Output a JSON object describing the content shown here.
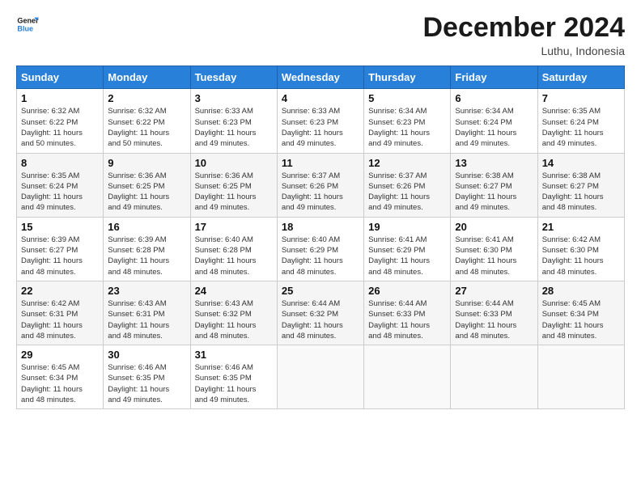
{
  "logo": {
    "line1": "General",
    "line2": "Blue"
  },
  "title": "December 2024",
  "location": "Luthu, Indonesia",
  "days_header": [
    "Sunday",
    "Monday",
    "Tuesday",
    "Wednesday",
    "Thursday",
    "Friday",
    "Saturday"
  ],
  "weeks": [
    [
      {
        "day": "1",
        "info": "Sunrise: 6:32 AM\nSunset: 6:22 PM\nDaylight: 11 hours\nand 50 minutes."
      },
      {
        "day": "2",
        "info": "Sunrise: 6:32 AM\nSunset: 6:22 PM\nDaylight: 11 hours\nand 50 minutes."
      },
      {
        "day": "3",
        "info": "Sunrise: 6:33 AM\nSunset: 6:23 PM\nDaylight: 11 hours\nand 49 minutes."
      },
      {
        "day": "4",
        "info": "Sunrise: 6:33 AM\nSunset: 6:23 PM\nDaylight: 11 hours\nand 49 minutes."
      },
      {
        "day": "5",
        "info": "Sunrise: 6:34 AM\nSunset: 6:23 PM\nDaylight: 11 hours\nand 49 minutes."
      },
      {
        "day": "6",
        "info": "Sunrise: 6:34 AM\nSunset: 6:24 PM\nDaylight: 11 hours\nand 49 minutes."
      },
      {
        "day": "7",
        "info": "Sunrise: 6:35 AM\nSunset: 6:24 PM\nDaylight: 11 hours\nand 49 minutes."
      }
    ],
    [
      {
        "day": "8",
        "info": "Sunrise: 6:35 AM\nSunset: 6:24 PM\nDaylight: 11 hours\nand 49 minutes."
      },
      {
        "day": "9",
        "info": "Sunrise: 6:36 AM\nSunset: 6:25 PM\nDaylight: 11 hours\nand 49 minutes."
      },
      {
        "day": "10",
        "info": "Sunrise: 6:36 AM\nSunset: 6:25 PM\nDaylight: 11 hours\nand 49 minutes."
      },
      {
        "day": "11",
        "info": "Sunrise: 6:37 AM\nSunset: 6:26 PM\nDaylight: 11 hours\nand 49 minutes."
      },
      {
        "day": "12",
        "info": "Sunrise: 6:37 AM\nSunset: 6:26 PM\nDaylight: 11 hours\nand 49 minutes."
      },
      {
        "day": "13",
        "info": "Sunrise: 6:38 AM\nSunset: 6:27 PM\nDaylight: 11 hours\nand 49 minutes."
      },
      {
        "day": "14",
        "info": "Sunrise: 6:38 AM\nSunset: 6:27 PM\nDaylight: 11 hours\nand 48 minutes."
      }
    ],
    [
      {
        "day": "15",
        "info": "Sunrise: 6:39 AM\nSunset: 6:27 PM\nDaylight: 11 hours\nand 48 minutes."
      },
      {
        "day": "16",
        "info": "Sunrise: 6:39 AM\nSunset: 6:28 PM\nDaylight: 11 hours\nand 48 minutes."
      },
      {
        "day": "17",
        "info": "Sunrise: 6:40 AM\nSunset: 6:28 PM\nDaylight: 11 hours\nand 48 minutes."
      },
      {
        "day": "18",
        "info": "Sunrise: 6:40 AM\nSunset: 6:29 PM\nDaylight: 11 hours\nand 48 minutes."
      },
      {
        "day": "19",
        "info": "Sunrise: 6:41 AM\nSunset: 6:29 PM\nDaylight: 11 hours\nand 48 minutes."
      },
      {
        "day": "20",
        "info": "Sunrise: 6:41 AM\nSunset: 6:30 PM\nDaylight: 11 hours\nand 48 minutes."
      },
      {
        "day": "21",
        "info": "Sunrise: 6:42 AM\nSunset: 6:30 PM\nDaylight: 11 hours\nand 48 minutes."
      }
    ],
    [
      {
        "day": "22",
        "info": "Sunrise: 6:42 AM\nSunset: 6:31 PM\nDaylight: 11 hours\nand 48 minutes."
      },
      {
        "day": "23",
        "info": "Sunrise: 6:43 AM\nSunset: 6:31 PM\nDaylight: 11 hours\nand 48 minutes."
      },
      {
        "day": "24",
        "info": "Sunrise: 6:43 AM\nSunset: 6:32 PM\nDaylight: 11 hours\nand 48 minutes."
      },
      {
        "day": "25",
        "info": "Sunrise: 6:44 AM\nSunset: 6:32 PM\nDaylight: 11 hours\nand 48 minutes."
      },
      {
        "day": "26",
        "info": "Sunrise: 6:44 AM\nSunset: 6:33 PM\nDaylight: 11 hours\nand 48 minutes."
      },
      {
        "day": "27",
        "info": "Sunrise: 6:44 AM\nSunset: 6:33 PM\nDaylight: 11 hours\nand 48 minutes."
      },
      {
        "day": "28",
        "info": "Sunrise: 6:45 AM\nSunset: 6:34 PM\nDaylight: 11 hours\nand 48 minutes."
      }
    ],
    [
      {
        "day": "29",
        "info": "Sunrise: 6:45 AM\nSunset: 6:34 PM\nDaylight: 11 hours\nand 48 minutes."
      },
      {
        "day": "30",
        "info": "Sunrise: 6:46 AM\nSunset: 6:35 PM\nDaylight: 11 hours\nand 49 minutes."
      },
      {
        "day": "31",
        "info": "Sunrise: 6:46 AM\nSunset: 6:35 PM\nDaylight: 11 hours\nand 49 minutes."
      },
      {
        "day": "",
        "info": ""
      },
      {
        "day": "",
        "info": ""
      },
      {
        "day": "",
        "info": ""
      },
      {
        "day": "",
        "info": ""
      }
    ]
  ]
}
